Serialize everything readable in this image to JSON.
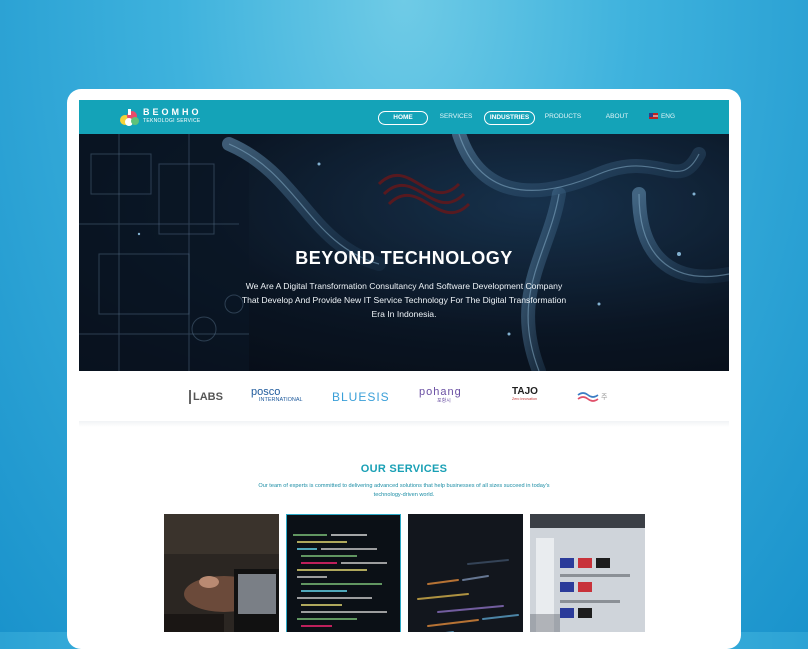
{
  "nav": {
    "logo_name": "BEOMHO",
    "logo_sub": "TEKNOLOGI SERVICE",
    "items": [
      {
        "label": "HOME",
        "active": true
      },
      {
        "label": "SERVICES",
        "active": false
      },
      {
        "label": "INDUSTRIES",
        "active": true
      },
      {
        "label": "PRODUCTS",
        "active": false
      },
      {
        "label": "ABOUT",
        "active": false
      }
    ],
    "language": "ENG",
    "language_icon": "us-flag-icon"
  },
  "hero": {
    "title": "BEYOND TECHNOLOGY",
    "subtitle": "We Are A Digital Transformation Consultancy And Software Development Company That Develop And Provide New IT Service Technology For The Digital Transformation Era In Indonesia."
  },
  "clients": {
    "labs": "LABS",
    "posco_1": "posco",
    "posco_2": "INTERNATIONAL",
    "bluesis": "BLUESIS",
    "pohang_1": "pohang",
    "pohang_2": "포항시",
    "tajo_1": "TAJO",
    "tajo_2": "Zero Innovation",
    "last": "주"
  },
  "services": {
    "title": "OUR SERVICES",
    "description": "Our team of experts is committed to delivering advanced solutions that help businesses of all sizes succeed in today's technology-driven world."
  },
  "colors": {
    "brand": "#14a3b8",
    "accent_text": "#19a0b5",
    "background": "#3eb2dd"
  }
}
